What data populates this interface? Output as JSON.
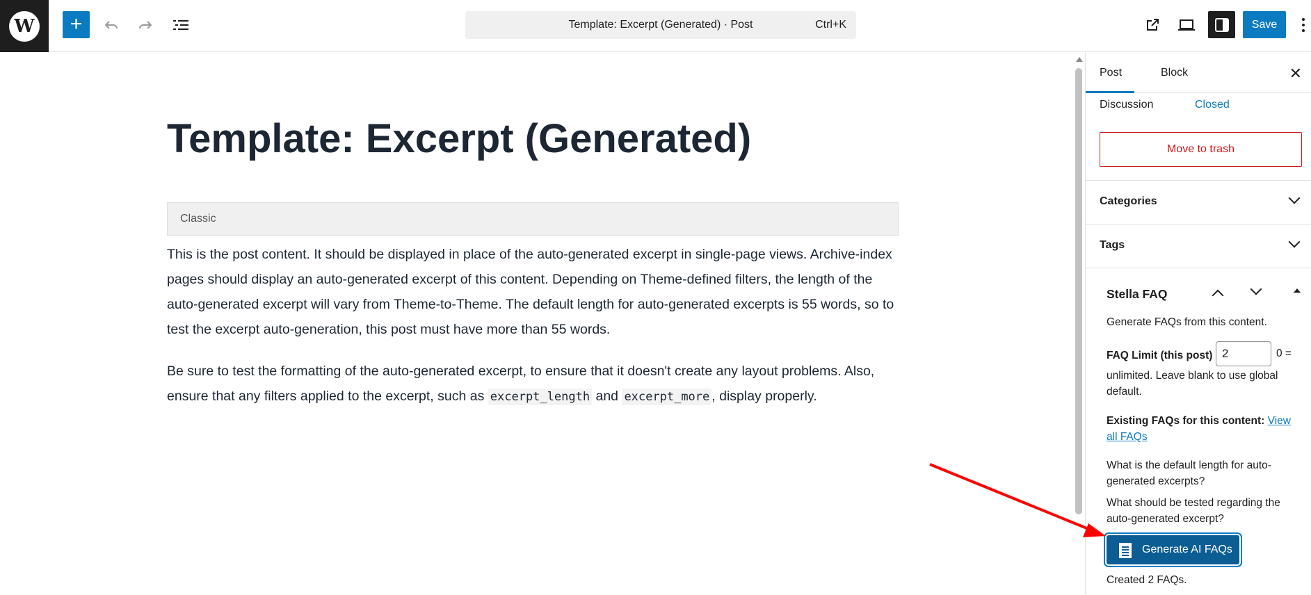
{
  "app": {
    "doc_title": "Template: Excerpt (Generated) · Post",
    "shortcut": "Ctrl+K",
    "save_label": "Save",
    "accent_color": "#0b7bc1"
  },
  "toolbar": {
    "icons": [
      "wordpress-icon",
      "plus-icon",
      "undo-icon",
      "redo-icon",
      "list-view-icon",
      "external-link-icon",
      "preview-icon",
      "sidebar-icon",
      "more-icon"
    ]
  },
  "editor": {
    "title": "Template: Excerpt (Generated)",
    "block_label": "Classic",
    "paragraph1": "This is the post content. It should be displayed in place of the auto-generated excerpt in single-page views. Archive-index pages should display an auto-generated excerpt of this content. Depending on Theme-defined filters, the length of the auto-generated excerpt will vary from Theme-to-Theme. The default length for auto-generated excerpts is 55 words, so to test the excerpt auto-generation, this post must have more than 55 words.",
    "paragraph2_a": "Be sure to test the formatting of the auto-generated excerpt, to ensure that it doesn't create any layout problems. Also, ensure that any filters applied to the excerpt, such as ",
    "code1": "excerpt_length",
    "paragraph2_b": " and ",
    "code2": "excerpt_more",
    "paragraph2_c": ", display properly."
  },
  "sidebar": {
    "tabs": [
      {
        "label": "Post"
      },
      {
        "label": "Block"
      }
    ],
    "discussion_label": "Discussion",
    "discussion_value": "Closed",
    "trash_label": "Move to trash",
    "panels": [
      {
        "title": "Categories"
      },
      {
        "title": "Tags"
      }
    ],
    "faq": {
      "title": "Stella FAQ",
      "intro": "Generate FAQs from this content.",
      "limit_label": "FAQ Limit (this post)",
      "limit_value": "2",
      "limit_suffix": "0 =",
      "limit_help": "unlimited. Leave blank to use global default.",
      "existing_label": "Existing FAQs for this content:",
      "view_all_link": "View all FAQs",
      "questions": [
        "What is the default length for auto-generated excerpts?",
        "What should be tested regarding the auto-generated excerpt?"
      ],
      "generate_label": "Generate AI FAQs",
      "status": "Created 2 FAQs."
    }
  }
}
